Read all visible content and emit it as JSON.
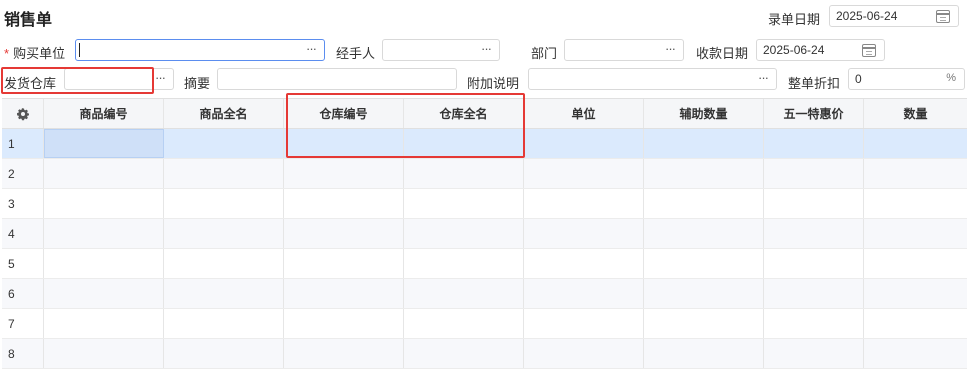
{
  "form": {
    "title": "销售单",
    "entry_date_label": "录单日期",
    "entry_date_value": "2025-06-24",
    "buyer_required_mark": "*",
    "buyer_label": "购买单位",
    "buyer_value": "",
    "handler_label": "经手人",
    "dept_label": "部门",
    "receipt_date_label": "收款日期",
    "receipt_date_value": "2025-06-24",
    "warehouse_label": "发货仓库",
    "summary_label": "摘要",
    "extra_label": "附加说明",
    "discount_label": "整单折扣",
    "discount_value": "0",
    "ellipsis": "···",
    "percent_symbol": "%"
  },
  "table": {
    "settings_icon": "gear-icon",
    "columns": [
      "商品编号",
      "商品全名",
      "仓库编号",
      "仓库全名",
      "单位",
      "辅助数量",
      "五一特惠价",
      "数量"
    ],
    "rows": [
      "1",
      "2",
      "3",
      "4",
      "5",
      "6",
      "7",
      "8"
    ]
  },
  "colors": {
    "highlight_box": "#e53935",
    "selected_row": "#dbeafd",
    "header_bg": "#f5f6f8"
  }
}
